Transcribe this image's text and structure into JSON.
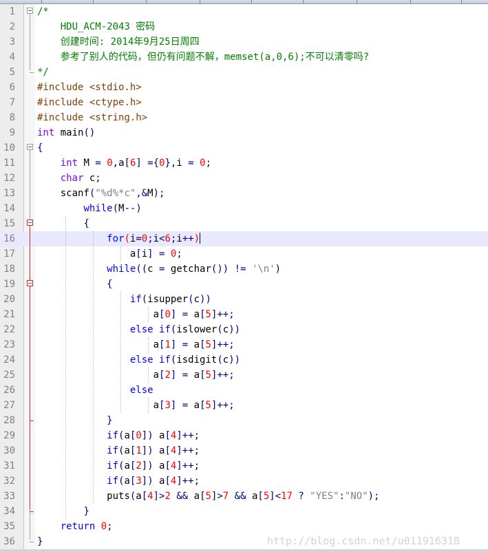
{
  "window": {
    "tabs": [
      "",
      "",
      "",
      "",
      "",
      "",
      "",
      "",
      ""
    ]
  },
  "editor": {
    "current_line": 16,
    "watermark": "http://blog.csdn.net/u011916318",
    "lines": [
      {
        "n": "1",
        "tokens": [
          {
            "t": "/*",
            "c": "cmt"
          }
        ]
      },
      {
        "n": "2",
        "tokens": [
          {
            "t": "    HDU_ACM-2043 密码",
            "c": "cmt"
          }
        ]
      },
      {
        "n": "3",
        "tokens": [
          {
            "t": "    创建时间: 2014年9月25日周四",
            "c": "cmt"
          }
        ]
      },
      {
        "n": "4",
        "tokens": [
          {
            "t": "    参考了别人的代码，但仍有问题不解，memset(a,0,6);不可以清零吗?",
            "c": "cmt"
          }
        ]
      },
      {
        "n": "5",
        "tokens": [
          {
            "t": "*/",
            "c": "cmt"
          }
        ]
      },
      {
        "n": "6",
        "tokens": [
          {
            "t": "#include <stdio.h>",
            "c": "pp"
          }
        ]
      },
      {
        "n": "7",
        "tokens": [
          {
            "t": "#include <ctype.h>",
            "c": "pp"
          }
        ]
      },
      {
        "n": "8",
        "tokens": [
          {
            "t": "#include <string.h>",
            "c": "pp"
          }
        ]
      },
      {
        "n": "9",
        "tokens": [
          {
            "t": "int",
            "c": "typ"
          },
          {
            "t": " main",
            "c": ""
          },
          {
            "t": "()",
            "c": "op"
          }
        ]
      },
      {
        "n": "10",
        "tokens": [
          {
            "t": "{",
            "c": "op"
          }
        ]
      },
      {
        "n": "11",
        "tokens": [
          {
            "t": "    ",
            "c": ""
          },
          {
            "t": "int",
            "c": "typ"
          },
          {
            "t": " M ",
            "c": ""
          },
          {
            "t": "=",
            "c": "op"
          },
          {
            "t": " ",
            "c": ""
          },
          {
            "t": "0",
            "c": "num"
          },
          {
            "t": ",",
            "c": "op"
          },
          {
            "t": "a",
            "c": ""
          },
          {
            "t": "[",
            "c": "op"
          },
          {
            "t": "6",
            "c": "num"
          },
          {
            "t": "]",
            "c": "op"
          },
          {
            "t": " ",
            "c": ""
          },
          {
            "t": "={",
            "c": "op"
          },
          {
            "t": "0",
            "c": "num"
          },
          {
            "t": "},",
            "c": "op"
          },
          {
            "t": "i ",
            "c": ""
          },
          {
            "t": "=",
            "c": "op"
          },
          {
            "t": " ",
            "c": ""
          },
          {
            "t": "0",
            "c": "num"
          },
          {
            "t": ";",
            "c": "op"
          }
        ]
      },
      {
        "n": "12",
        "tokens": [
          {
            "t": "    ",
            "c": ""
          },
          {
            "t": "char",
            "c": "typ"
          },
          {
            "t": " c",
            "c": ""
          },
          {
            "t": ";",
            "c": "op"
          }
        ]
      },
      {
        "n": "13",
        "tokens": [
          {
            "t": "    scanf",
            "c": ""
          },
          {
            "t": "(",
            "c": "op"
          },
          {
            "t": "\"%d%*c\"",
            "c": "str"
          },
          {
            "t": ",&",
            "c": "op"
          },
          {
            "t": "M",
            "c": ""
          },
          {
            "t": ");",
            "c": "op"
          }
        ]
      },
      {
        "n": "14",
        "tokens": [
          {
            "t": "        ",
            "c": ""
          },
          {
            "t": "while",
            "c": "kw"
          },
          {
            "t": "(",
            "c": "op"
          },
          {
            "t": "M",
            "c": ""
          },
          {
            "t": "--)",
            "c": "op"
          }
        ]
      },
      {
        "n": "15",
        "tokens": [
          {
            "t": "        ",
            "c": ""
          },
          {
            "t": "{",
            "c": "op"
          }
        ]
      },
      {
        "n": "16",
        "tokens": [
          {
            "t": "            ",
            "c": ""
          },
          {
            "t": "for",
            "c": "kw"
          },
          {
            "t": "(",
            "c": "num"
          },
          {
            "t": "i",
            "c": ""
          },
          {
            "t": "=",
            "c": "op"
          },
          {
            "t": "0",
            "c": "num"
          },
          {
            "t": ";",
            "c": "op"
          },
          {
            "t": "i",
            "c": ""
          },
          {
            "t": "<",
            "c": "op"
          },
          {
            "t": "6",
            "c": "num"
          },
          {
            "t": ";",
            "c": "op"
          },
          {
            "t": "i",
            "c": ""
          },
          {
            "t": "++",
            "c": "op"
          },
          {
            "t": ")",
            "c": "num"
          }
        ]
      },
      {
        "n": "17",
        "tokens": [
          {
            "t": "                a",
            "c": ""
          },
          {
            "t": "[",
            "c": "op"
          },
          {
            "t": "i",
            "c": ""
          },
          {
            "t": "]",
            "c": "op"
          },
          {
            "t": " ",
            "c": ""
          },
          {
            "t": "=",
            "c": "op"
          },
          {
            "t": " ",
            "c": ""
          },
          {
            "t": "0",
            "c": "num"
          },
          {
            "t": ";",
            "c": "op"
          }
        ]
      },
      {
        "n": "18",
        "tokens": [
          {
            "t": "            ",
            "c": ""
          },
          {
            "t": "while",
            "c": "kw"
          },
          {
            "t": "((",
            "c": "op"
          },
          {
            "t": "c ",
            "c": ""
          },
          {
            "t": "=",
            "c": "op"
          },
          {
            "t": " getchar",
            "c": ""
          },
          {
            "t": "())",
            "c": "op"
          },
          {
            "t": " ",
            "c": ""
          },
          {
            "t": "!=",
            "c": "op"
          },
          {
            "t": " ",
            "c": ""
          },
          {
            "t": "'\\n'",
            "c": "str"
          },
          {
            "t": ")",
            "c": "op"
          }
        ]
      },
      {
        "n": "19",
        "tokens": [
          {
            "t": "            ",
            "c": ""
          },
          {
            "t": "{",
            "c": "op"
          }
        ]
      },
      {
        "n": "20",
        "tokens": [
          {
            "t": "                ",
            "c": ""
          },
          {
            "t": "if",
            "c": "kw"
          },
          {
            "t": "(",
            "c": "op"
          },
          {
            "t": "isupper",
            "c": ""
          },
          {
            "t": "(",
            "c": "op"
          },
          {
            "t": "c",
            "c": ""
          },
          {
            "t": "))",
            "c": "op"
          }
        ]
      },
      {
        "n": "21",
        "tokens": [
          {
            "t": "                    a",
            "c": ""
          },
          {
            "t": "[",
            "c": "op"
          },
          {
            "t": "0",
            "c": "num"
          },
          {
            "t": "]",
            "c": "op"
          },
          {
            "t": " ",
            "c": ""
          },
          {
            "t": "=",
            "c": "op"
          },
          {
            "t": " a",
            "c": ""
          },
          {
            "t": "[",
            "c": "op"
          },
          {
            "t": "5",
            "c": "num"
          },
          {
            "t": "]++;",
            "c": "op"
          }
        ]
      },
      {
        "n": "22",
        "tokens": [
          {
            "t": "                ",
            "c": ""
          },
          {
            "t": "else",
            "c": "kw"
          },
          {
            "t": " ",
            "c": ""
          },
          {
            "t": "if",
            "c": "kw"
          },
          {
            "t": "(",
            "c": "op"
          },
          {
            "t": "islower",
            "c": ""
          },
          {
            "t": "(",
            "c": "op"
          },
          {
            "t": "c",
            "c": ""
          },
          {
            "t": "))",
            "c": "op"
          }
        ]
      },
      {
        "n": "23",
        "tokens": [
          {
            "t": "                    a",
            "c": ""
          },
          {
            "t": "[",
            "c": "op"
          },
          {
            "t": "1",
            "c": "num"
          },
          {
            "t": "]",
            "c": "op"
          },
          {
            "t": " ",
            "c": ""
          },
          {
            "t": "=",
            "c": "op"
          },
          {
            "t": " a",
            "c": ""
          },
          {
            "t": "[",
            "c": "op"
          },
          {
            "t": "5",
            "c": "num"
          },
          {
            "t": "]++;",
            "c": "op"
          }
        ]
      },
      {
        "n": "24",
        "tokens": [
          {
            "t": "                ",
            "c": ""
          },
          {
            "t": "else",
            "c": "kw"
          },
          {
            "t": " ",
            "c": ""
          },
          {
            "t": "if",
            "c": "kw"
          },
          {
            "t": "(",
            "c": "op"
          },
          {
            "t": "isdigit",
            "c": ""
          },
          {
            "t": "(",
            "c": "op"
          },
          {
            "t": "c",
            "c": ""
          },
          {
            "t": "))",
            "c": "op"
          }
        ]
      },
      {
        "n": "25",
        "tokens": [
          {
            "t": "                    a",
            "c": ""
          },
          {
            "t": "[",
            "c": "op"
          },
          {
            "t": "2",
            "c": "num"
          },
          {
            "t": "]",
            "c": "op"
          },
          {
            "t": " ",
            "c": ""
          },
          {
            "t": "=",
            "c": "op"
          },
          {
            "t": " a",
            "c": ""
          },
          {
            "t": "[",
            "c": "op"
          },
          {
            "t": "5",
            "c": "num"
          },
          {
            "t": "]++;",
            "c": "op"
          }
        ]
      },
      {
        "n": "26",
        "tokens": [
          {
            "t": "                ",
            "c": ""
          },
          {
            "t": "else",
            "c": "kw"
          }
        ]
      },
      {
        "n": "27",
        "tokens": [
          {
            "t": "                    a",
            "c": ""
          },
          {
            "t": "[",
            "c": "op"
          },
          {
            "t": "3",
            "c": "num"
          },
          {
            "t": "]",
            "c": "op"
          },
          {
            "t": " ",
            "c": ""
          },
          {
            "t": "=",
            "c": "op"
          },
          {
            "t": " a",
            "c": ""
          },
          {
            "t": "[",
            "c": "op"
          },
          {
            "t": "5",
            "c": "num"
          },
          {
            "t": "]++;",
            "c": "op"
          }
        ]
      },
      {
        "n": "28",
        "tokens": [
          {
            "t": "            ",
            "c": ""
          },
          {
            "t": "}",
            "c": "op"
          }
        ]
      },
      {
        "n": "29",
        "tokens": [
          {
            "t": "            ",
            "c": ""
          },
          {
            "t": "if",
            "c": "kw"
          },
          {
            "t": "(",
            "c": "op"
          },
          {
            "t": "a",
            "c": ""
          },
          {
            "t": "[",
            "c": "op"
          },
          {
            "t": "0",
            "c": "num"
          },
          {
            "t": "])",
            "c": "op"
          },
          {
            "t": " a",
            "c": ""
          },
          {
            "t": "[",
            "c": "op"
          },
          {
            "t": "4",
            "c": "num"
          },
          {
            "t": "]++;",
            "c": "op"
          }
        ]
      },
      {
        "n": "30",
        "tokens": [
          {
            "t": "            ",
            "c": ""
          },
          {
            "t": "if",
            "c": "kw"
          },
          {
            "t": "(",
            "c": "op"
          },
          {
            "t": "a",
            "c": ""
          },
          {
            "t": "[",
            "c": "op"
          },
          {
            "t": "1",
            "c": "num"
          },
          {
            "t": "])",
            "c": "op"
          },
          {
            "t": " a",
            "c": ""
          },
          {
            "t": "[",
            "c": "op"
          },
          {
            "t": "4",
            "c": "num"
          },
          {
            "t": "]++;",
            "c": "op"
          }
        ]
      },
      {
        "n": "31",
        "tokens": [
          {
            "t": "            ",
            "c": ""
          },
          {
            "t": "if",
            "c": "kw"
          },
          {
            "t": "(",
            "c": "op"
          },
          {
            "t": "a",
            "c": ""
          },
          {
            "t": "[",
            "c": "op"
          },
          {
            "t": "2",
            "c": "num"
          },
          {
            "t": "])",
            "c": "op"
          },
          {
            "t": " a",
            "c": ""
          },
          {
            "t": "[",
            "c": "op"
          },
          {
            "t": "4",
            "c": "num"
          },
          {
            "t": "]++;",
            "c": "op"
          }
        ]
      },
      {
        "n": "32",
        "tokens": [
          {
            "t": "            ",
            "c": ""
          },
          {
            "t": "if",
            "c": "kw"
          },
          {
            "t": "(",
            "c": "op"
          },
          {
            "t": "a",
            "c": ""
          },
          {
            "t": "[",
            "c": "op"
          },
          {
            "t": "3",
            "c": "num"
          },
          {
            "t": "])",
            "c": "op"
          },
          {
            "t": " a",
            "c": ""
          },
          {
            "t": "[",
            "c": "op"
          },
          {
            "t": "4",
            "c": "num"
          },
          {
            "t": "]++;",
            "c": "op"
          }
        ]
      },
      {
        "n": "33",
        "tokens": [
          {
            "t": "            puts",
            "c": ""
          },
          {
            "t": "(",
            "c": "op"
          },
          {
            "t": "a",
            "c": ""
          },
          {
            "t": "[",
            "c": "op"
          },
          {
            "t": "4",
            "c": "num"
          },
          {
            "t": "]>",
            "c": "op"
          },
          {
            "t": "2",
            "c": "num"
          },
          {
            "t": " ",
            "c": ""
          },
          {
            "t": "&&",
            "c": "op"
          },
          {
            "t": " a",
            "c": ""
          },
          {
            "t": "[",
            "c": "op"
          },
          {
            "t": "5",
            "c": "num"
          },
          {
            "t": "]>",
            "c": "op"
          },
          {
            "t": "7",
            "c": "num"
          },
          {
            "t": " ",
            "c": ""
          },
          {
            "t": "&&",
            "c": "op"
          },
          {
            "t": " a",
            "c": ""
          },
          {
            "t": "[",
            "c": "op"
          },
          {
            "t": "5",
            "c": "num"
          },
          {
            "t": "]<",
            "c": "op"
          },
          {
            "t": "17",
            "c": "num"
          },
          {
            "t": " ",
            "c": ""
          },
          {
            "t": "?",
            "c": "op"
          },
          {
            "t": " ",
            "c": ""
          },
          {
            "t": "\"YES\"",
            "c": "str"
          },
          {
            "t": ":",
            "c": "op"
          },
          {
            "t": "\"NO\"",
            "c": "str"
          },
          {
            "t": ");",
            "c": "op"
          }
        ]
      },
      {
        "n": "34",
        "tokens": [
          {
            "t": "        ",
            "c": ""
          },
          {
            "t": "}",
            "c": "op"
          }
        ]
      },
      {
        "n": "35",
        "tokens": [
          {
            "t": "    ",
            "c": ""
          },
          {
            "t": "return",
            "c": "kw"
          },
          {
            "t": " ",
            "c": ""
          },
          {
            "t": "0",
            "c": "num"
          },
          {
            "t": ";",
            "c": "op"
          }
        ]
      },
      {
        "n": "36",
        "tokens": [
          {
            "t": "}",
            "c": "op"
          }
        ]
      }
    ]
  }
}
